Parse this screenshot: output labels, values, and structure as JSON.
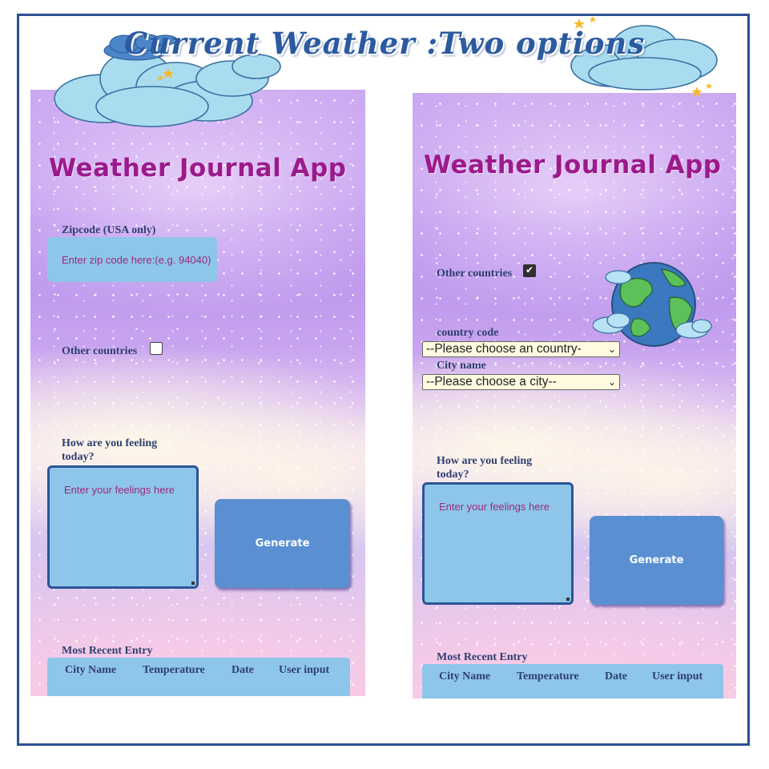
{
  "main_title": "Current Weather :Two options",
  "left_panel": {
    "app_title": "Weather Journal App",
    "zip_label": "Zipcode (USA only)",
    "zip_placeholder": "Enter zip code here:(e.g. 94040)",
    "other_countries_label": "Other countries",
    "other_countries_checked": false,
    "feeling_label": "How are you feeling today?",
    "feeling_placeholder": "Enter your feelings here",
    "generate_label": "Generate",
    "recent_label": "Most Recent Entry",
    "columns": [
      "City Name",
      "Temperature",
      "Date",
      "User input"
    ]
  },
  "right_panel": {
    "app_title": "Weather Journal App",
    "other_countries_label": "Other countries",
    "other_countries_checked": true,
    "country_code_label": "country code",
    "country_select_value": "--Please choose an country-",
    "city_name_label": "City name",
    "city_select_value": "--Please choose a city--",
    "feeling_label": "How are you feeling today?",
    "feeling_placeholder": "Enter your feelings here",
    "generate_label": "Generate",
    "recent_label": "Most Recent Entry",
    "columns": [
      "City Name",
      "Temperature",
      "Date",
      "User input"
    ]
  },
  "icons": {
    "checkmark": "✔",
    "chevron": "⌄"
  },
  "colors": {
    "frame_border": "#2b4f92",
    "title_blue": "#2c5aa0",
    "app_title_magenta": "#9c1a8c",
    "input_blue": "#8ec6ea",
    "button_blue": "#5a90d2"
  }
}
